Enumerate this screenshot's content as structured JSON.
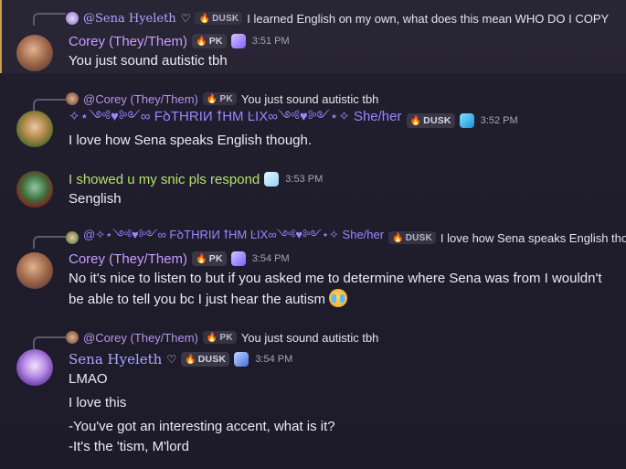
{
  "messages": [
    {
      "reply": {
        "author": "@Sena Hyeleth",
        "tag": "DUSK",
        "text": "I learned English on my own, what does this mean  WHO DO I COPY"
      },
      "author": "Corey (They/Them)",
      "tag": "PK",
      "time": "3:51 PM",
      "lines": [
        "You just sound autistic tbh"
      ]
    },
    {
      "reply": {
        "author": "@Corey (They/Them)",
        "tag": "PK",
        "text": "You just sound autistic tbh"
      },
      "author": "✧⋆༺♥༻∞ FꝺTHRIИ ꝉHM ĿIX∞༺♥༻⋆✧ She/her",
      "tag": "DUSK",
      "time": "3:52 PM",
      "lines": [
        "I love how Sena speaks English though."
      ]
    },
    {
      "author": "I showed u my snic pls respond",
      "time": "3:53 PM",
      "lines": [
        "Senglish"
      ]
    },
    {
      "reply": {
        "author": "@✧⋆༺♥༻∞ FꝺTHRIИ ꝉHM ĿIX∞༺♥༻⋆✧ She/her",
        "tag": "DUSK",
        "text": "I love how Sena speaks English though."
      },
      "author": "Corey (They/Them)",
      "tag": "PK",
      "time": "3:54 PM",
      "lines": [
        "No it's nice to listen to but if you asked me to determine where Sena was from I wouldn't",
        "be able to tell you bc I just hear the autism"
      ]
    },
    {
      "reply": {
        "author": "@Corey (They/Them)",
        "tag": "PK",
        "text": "You just sound autistic tbh"
      },
      "author": "Sena Hyeleth",
      "tag": "DUSK",
      "time": "3:54 PM",
      "lines": [
        "LMAO",
        "I love this",
        "-You've got an interesting accent, what is it?",
        "-It's the 'tism, M'lord"
      ]
    }
  ],
  "colors": {
    "corey": "#c99dff",
    "ferith": "#9b86ff",
    "snic": "#b6e36b",
    "sena": "#b1a6ff",
    "highlight_bar": "#c8a04a"
  },
  "icons": {
    "pk_flame": "flame-icon",
    "dusk_flame": "purple-flame-icon",
    "gem": "gem-icon",
    "ice": "ice-cube-icon",
    "sob_emoji": "loudly-crying-face-emoji"
  }
}
